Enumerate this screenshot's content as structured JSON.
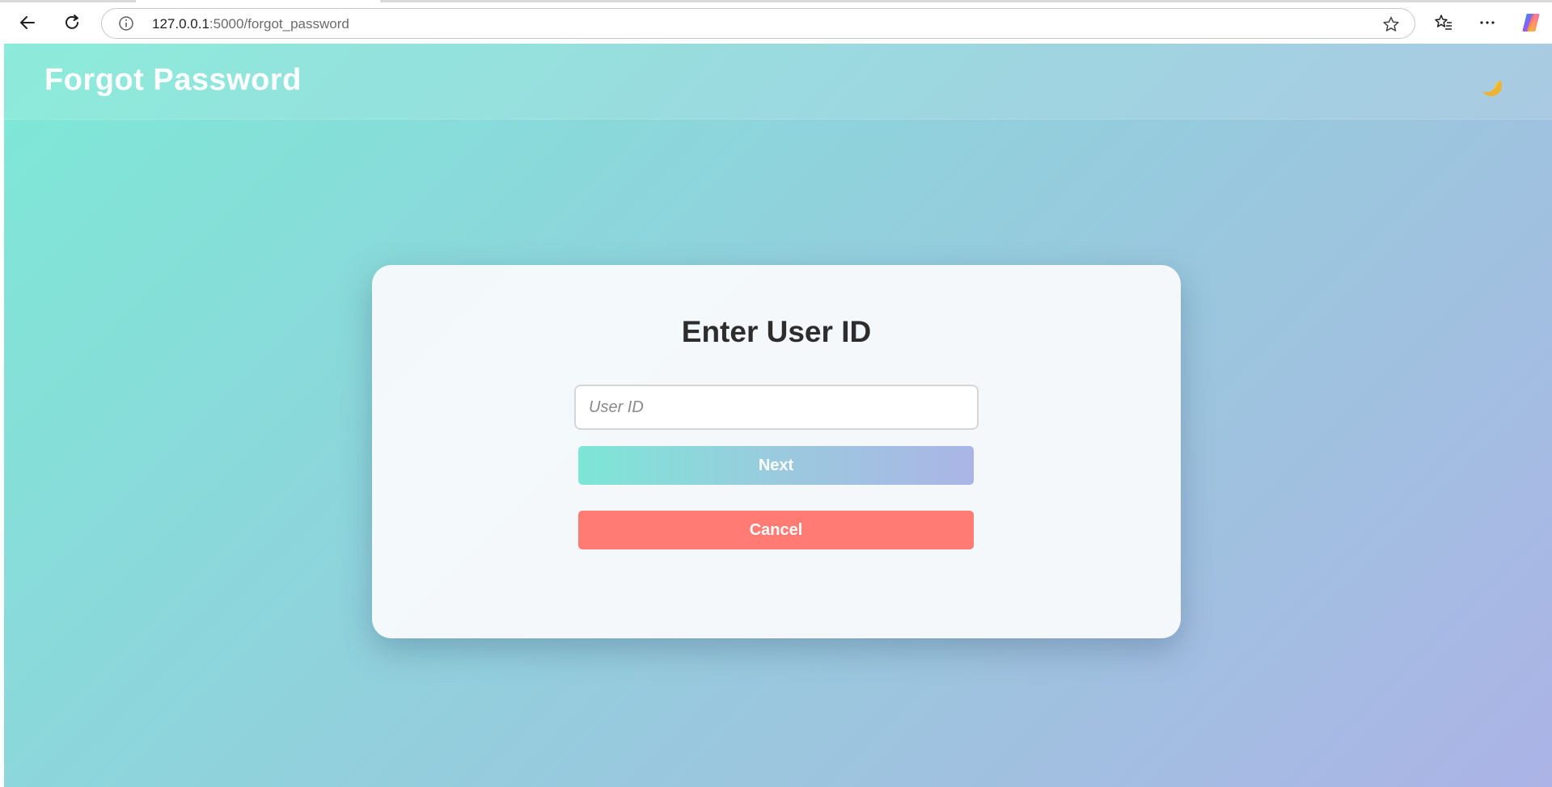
{
  "browser": {
    "url_host": "127.0.0.1",
    "url_path": ":5000/forgot_password"
  },
  "header": {
    "title": "Forgot Password",
    "theme_icon": "moon-icon"
  },
  "card": {
    "title": "Enter User ID",
    "input_placeholder": "User ID",
    "input_value": "",
    "next_label": "Next",
    "cancel_label": "Cancel"
  },
  "colors": {
    "accent_gradient_start": "#7de6d6",
    "accent_gradient_end": "#aab5e6",
    "cancel": "#ff7b73",
    "card_bg": "#f8fafc",
    "title_text": "#2d2d2d"
  }
}
